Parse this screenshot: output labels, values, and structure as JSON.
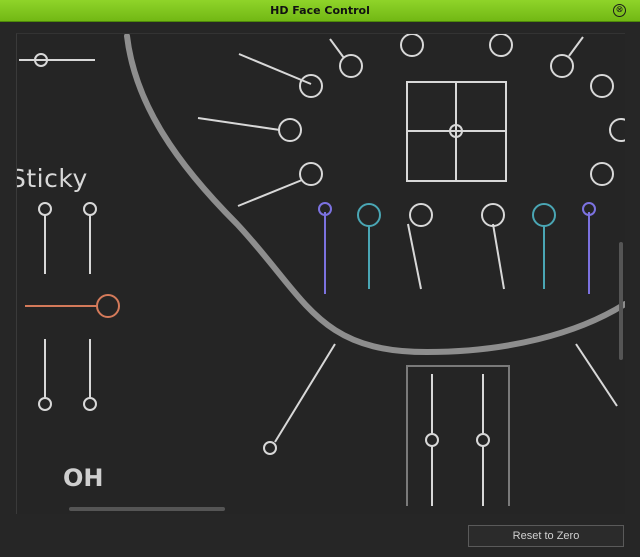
{
  "window": {
    "title": "HD Face Control",
    "close_glyph": "⊗"
  },
  "canvas": {
    "sticky_label": "Sticky",
    "mouth_label": "OH"
  },
  "footer": {
    "reset_label": "Reset to Zero"
  },
  "colors": {
    "titlebar": "#7bc41e",
    "control_stroke": "#d8d8d8",
    "face_outline": "#8e8e8e",
    "purple_slider": "#7c72e0",
    "teal_slider": "#4aa6b4",
    "orange_slider": "#d47a5a"
  }
}
